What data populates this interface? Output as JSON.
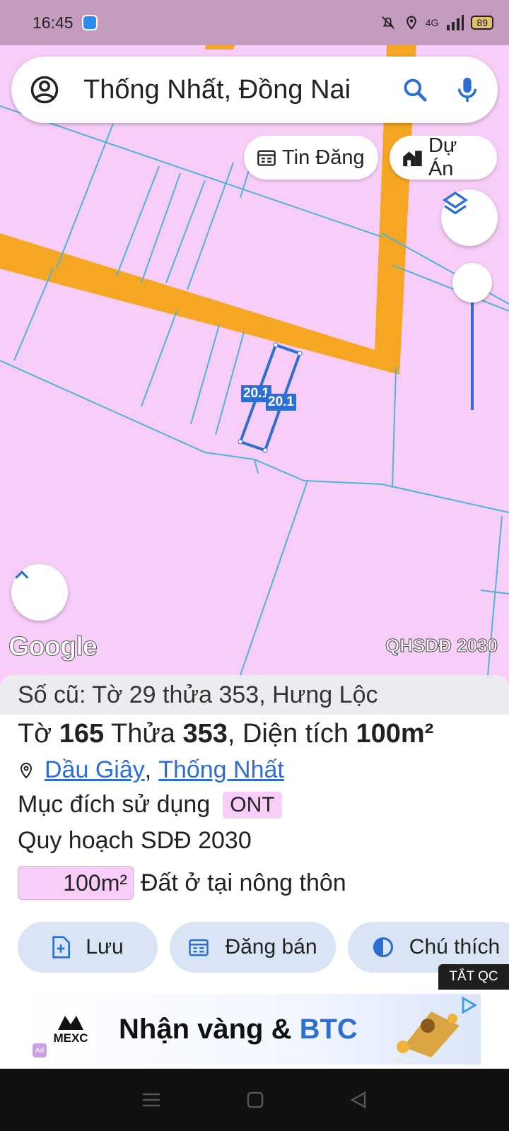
{
  "status_bar": {
    "time": "16:45",
    "battery": "89",
    "network": "4G"
  },
  "search": {
    "query": "Thống Nhất, Đồng Nai"
  },
  "chips": {
    "tin_dang": "Tin Đăng",
    "du_an": "Dự Án"
  },
  "map": {
    "parcel_labels": [
      "20.1",
      "20.1"
    ],
    "attribution": "Google",
    "layer_label": "QHSDĐ 2030",
    "colors": {
      "land": "#f8cef8",
      "road": "#f5a623",
      "boundary": "#4fb3d9",
      "selected": "#2c6fd1"
    }
  },
  "sheet": {
    "old_info": "Số cũ: Tờ 29 thửa 353, Hưng Lộc",
    "to_label": "Tờ",
    "to_value": "165",
    "thua_label": "Thửa",
    "thua_value": "353",
    "area_label": ", Diện tích",
    "area_value": "100m²",
    "location_1": "Dầu Giây",
    "location_sep": ",",
    "location_2": "Thống Nhất",
    "purpose_label": "Mục đích sử dụng",
    "purpose_code": "ONT",
    "plan_label": "Quy hoạch SDĐ 2030",
    "land_area": "100m²",
    "land_type": "Đất ở tại nông thôn"
  },
  "actions": {
    "save": "Lưu",
    "sell": "Đăng bán",
    "legend": "Chú thích"
  },
  "ad": {
    "close_label": "TẮT QC",
    "brand": "MEXC",
    "text_part1": "Nhận vàng & ",
    "text_part2": "BTC",
    "tag": "Ad"
  }
}
